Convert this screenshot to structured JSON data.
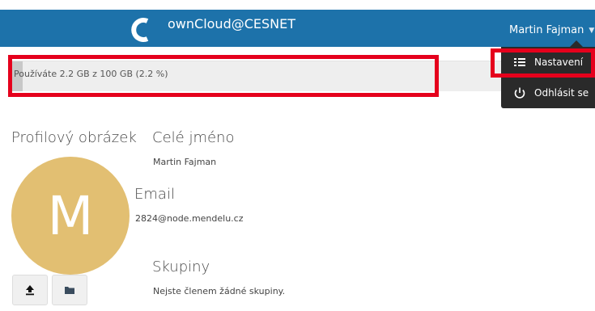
{
  "header": {
    "brand": "ownCloud@CESNET",
    "user_name": "Martin Fajman",
    "logo_letter": "C",
    "color": "#1d72aa"
  },
  "quota": {
    "text": "Používáte 2.2 GB z 100 GB (2.2 %)",
    "used_percent": 2.2
  },
  "dropdown": {
    "items": [
      {
        "label": "Nastavení",
        "icon": "list-icon"
      },
      {
        "label": "Odhlásit se",
        "icon": "power-icon"
      }
    ]
  },
  "profile": {
    "picture_label": "Profilový obrázek",
    "avatar_letter": "M",
    "avatar_color": "#e2bf72",
    "upload_icon": "upload-icon",
    "folder_icon": "folder-icon"
  },
  "full_name": {
    "label": "Celé jméno",
    "value": "Martin Fajman"
  },
  "email": {
    "label": "Email",
    "value": "2824@node.mendelu.cz"
  },
  "groups": {
    "label": "Skupiny",
    "value": "Nejste členem žádné skupiny."
  },
  "annotation_color": "#e5001c"
}
